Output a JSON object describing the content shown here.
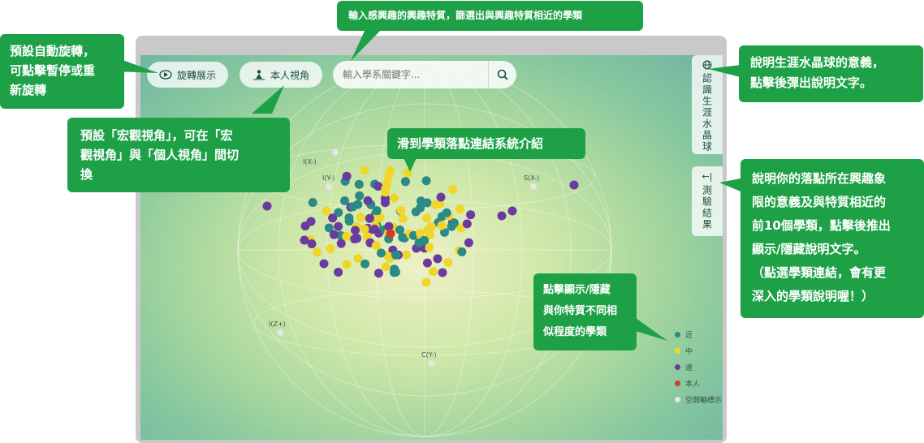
{
  "toolbar": {
    "rotate_label": "旋轉展示",
    "view_label": "本人視角",
    "search_placeholder": "輸入學系關鍵字..."
  },
  "side_tabs": {
    "crystal_label": "認識生涯水晶球",
    "result_label": "測驗結果",
    "result_arrow": "←|"
  },
  "callouts": {
    "rotate": [
      "預設自動旋轉，",
      "可點擊暫停或重",
      "新旋轉"
    ],
    "view": [
      "預設「宏觀視角」，可在「宏",
      "觀視角」與「個人視角」間切",
      "換"
    ],
    "search": [
      "輸入感興趣的興趣特質，篩選出與興趣特質相近的學類"
    ],
    "crystal": [
      "說明生涯水晶球的意義，",
      "點擊後彈出說明文字。"
    ],
    "hover": [
      "滑到學類落點連結系統介紹"
    ],
    "result": [
      "說明你的落點所在興趣象",
      "限的意義及與特質相近的",
      "前10個學類，點擊後推出",
      "顯示/隱藏說明文字。",
      "（點選學類連結，會有更",
      "深入的學類說明喔！）"
    ],
    "legend": [
      "點擊顯示/隱藏",
      "與你特質不同相",
      "似程度的學類"
    ]
  },
  "legend": [
    {
      "label": "近",
      "color": "#2a8a86"
    },
    {
      "label": "中",
      "color": "#f0d52a"
    },
    {
      "label": "遠",
      "color": "#6a3aa0"
    },
    {
      "label": "本人",
      "color": "#d43a2a"
    },
    {
      "label": "空間軸標示",
      "color": "#e6e6e6"
    }
  ],
  "axis_labels": {
    "top": "I(X-)",
    "left_top": "I(Y-)",
    "right_top": "S(X-)",
    "left_bottom": "I(Z+)",
    "bottom": "C(Y-)"
  },
  "colors": {
    "accent_green": "#1ea146",
    "near": "#2a8a86",
    "mid": "#f0d52a",
    "far": "#6a3aa0",
    "self": "#d43a2a"
  }
}
